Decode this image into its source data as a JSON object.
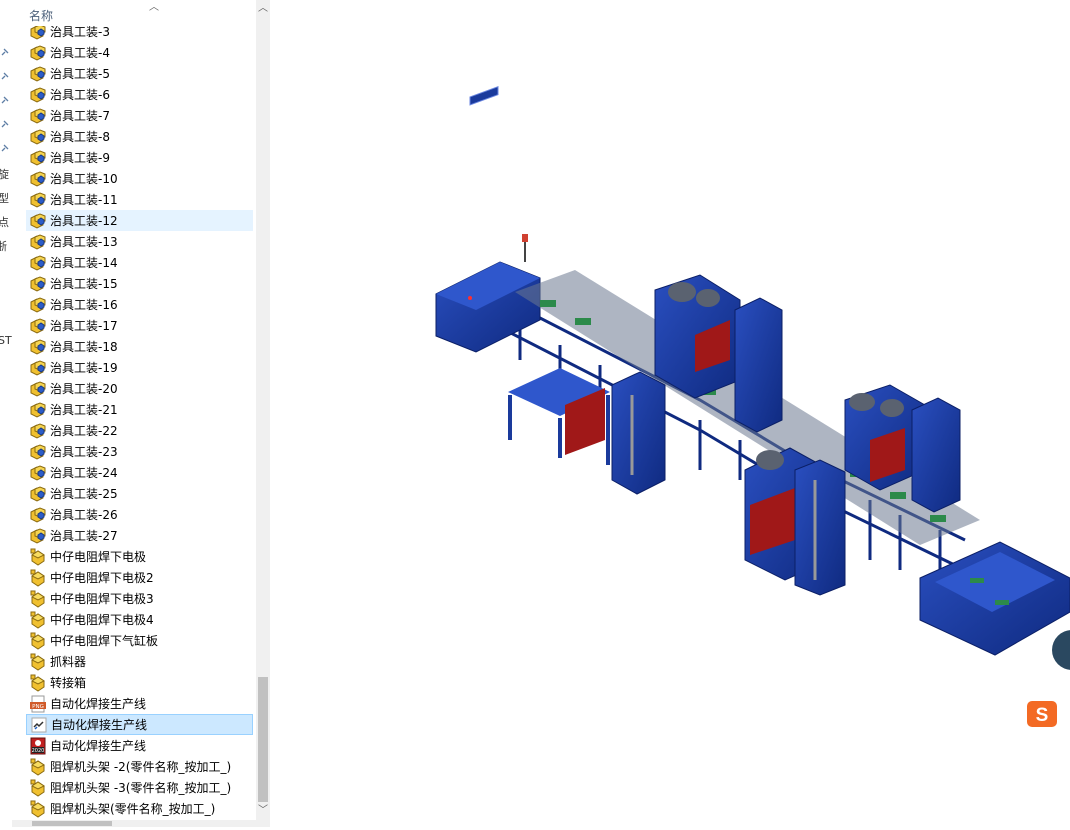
{
  "explorer": {
    "column_name": "名称",
    "rows": [
      {
        "label": "治具工装-3",
        "icon": "assembly-icon"
      },
      {
        "label": "治具工装-4",
        "icon": "assembly-icon"
      },
      {
        "label": "治具工装-5",
        "icon": "assembly-icon"
      },
      {
        "label": "治具工装-6",
        "icon": "assembly-icon"
      },
      {
        "label": "治具工装-7",
        "icon": "assembly-icon"
      },
      {
        "label": "治具工装-8",
        "icon": "assembly-icon"
      },
      {
        "label": "治具工装-9",
        "icon": "assembly-icon"
      },
      {
        "label": "治具工装-10",
        "icon": "assembly-icon"
      },
      {
        "label": "治具工装-11",
        "icon": "assembly-icon"
      },
      {
        "label": "治具工装-12",
        "icon": "assembly-icon",
        "state": "hover"
      },
      {
        "label": "治具工装-13",
        "icon": "assembly-icon"
      },
      {
        "label": "治具工装-14",
        "icon": "assembly-icon"
      },
      {
        "label": "治具工装-15",
        "icon": "assembly-icon"
      },
      {
        "label": "治具工装-16",
        "icon": "assembly-icon"
      },
      {
        "label": "治具工装-17",
        "icon": "assembly-icon"
      },
      {
        "label": "治具工装-18",
        "icon": "assembly-icon"
      },
      {
        "label": "治具工装-19",
        "icon": "assembly-icon"
      },
      {
        "label": "治具工装-20",
        "icon": "assembly-icon"
      },
      {
        "label": "治具工装-21",
        "icon": "assembly-icon"
      },
      {
        "label": "治具工装-22",
        "icon": "assembly-icon"
      },
      {
        "label": "治具工装-23",
        "icon": "assembly-icon"
      },
      {
        "label": "治具工装-24",
        "icon": "assembly-icon"
      },
      {
        "label": "治具工装-25",
        "icon": "assembly-icon"
      },
      {
        "label": "治具工装-26",
        "icon": "assembly-icon"
      },
      {
        "label": "治具工装-27",
        "icon": "assembly-icon"
      },
      {
        "label": "中仔电阻焊下电极",
        "icon": "part-icon"
      },
      {
        "label": "中仔电阻焊下电极2",
        "icon": "part-icon"
      },
      {
        "label": "中仔电阻焊下电极3",
        "icon": "part-icon"
      },
      {
        "label": "中仔电阻焊下电极4",
        "icon": "part-icon"
      },
      {
        "label": "中仔电阻焊下气缸板",
        "icon": "part-icon"
      },
      {
        "label": "抓料器",
        "icon": "part-icon"
      },
      {
        "label": "转接箱",
        "icon": "part-icon"
      },
      {
        "label": "自动化焊接生产线",
        "icon": "png-file-icon"
      },
      {
        "label": "自动化焊接生产线",
        "icon": "shortcut-icon",
        "state": "selected"
      },
      {
        "label": "自动化焊接生产线",
        "icon": "edrawing-icon"
      },
      {
        "label": "阻焊机头架 -2(零件名称_按加工_)",
        "icon": "part-icon"
      },
      {
        "label": "阻焊机头架 -3(零件名称_按加工_)",
        "icon": "part-icon"
      },
      {
        "label": "阻焊机头架(零件名称_按加工_)",
        "icon": "part-icon"
      }
    ]
  },
  "left_strip": {
    "labels": [
      "旋",
      "型",
      "点",
      "浙",
      "ST"
    ]
  },
  "viewport": {
    "subject": "automated-welding-production-line-3d-model"
  },
  "ime": {
    "name": "sogou-ime-icon",
    "glyph": "S"
  },
  "colors": {
    "machine_blue": "#1a3a9c",
    "cabinet_red": "#a01818",
    "selection": "#cce8ff",
    "hover": "#e5f3ff"
  }
}
